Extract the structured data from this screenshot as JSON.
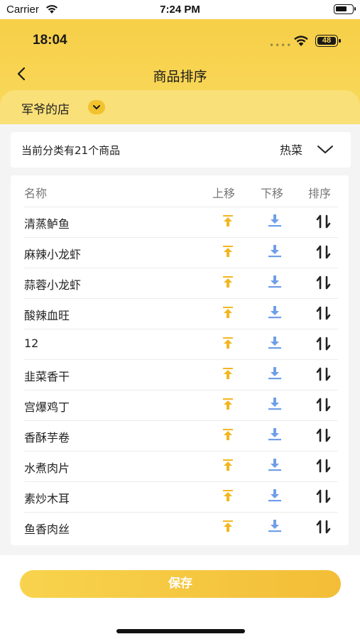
{
  "device_status": {
    "carrier": "Carrier",
    "time": "7:24 PM"
  },
  "app_status": {
    "time": "18:04",
    "battery": "48"
  },
  "navbar": {
    "title": "商品排序"
  },
  "shop": {
    "name": "军爷的店"
  },
  "summary": {
    "count_text": "当前分类有21个商品",
    "category": "热菜"
  },
  "table": {
    "headers": {
      "name": "名称",
      "up": "上移",
      "down": "下移",
      "sort": "排序"
    },
    "rows": [
      {
        "name": "清蒸鲈鱼"
      },
      {
        "name": "麻辣小龙虾"
      },
      {
        "name": "蒜蓉小龙虾"
      },
      {
        "name": "酸辣血旺"
      },
      {
        "name": "12"
      },
      {
        "name": "韭菜香干"
      },
      {
        "name": "宫爆鸡丁"
      },
      {
        "name": "香酥芋卷"
      },
      {
        "name": "水煮肉片"
      },
      {
        "name": "素炒木耳"
      },
      {
        "name": "鱼香肉丝"
      }
    ]
  },
  "actions": {
    "save_label": "保存"
  },
  "colors": {
    "brand_yellow": "#f8d352",
    "up_icon": "#f2b61f",
    "down_icon": "#6f9ee8",
    "sort_icon": "#222222"
  },
  "icons": {
    "up": "move-top-icon",
    "down": "move-bottom-icon",
    "sort": "sort-updown-icon"
  }
}
